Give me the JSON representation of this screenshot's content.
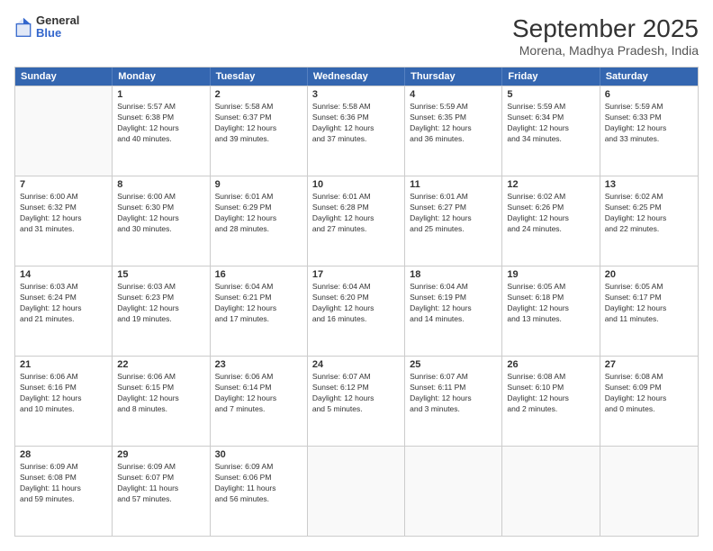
{
  "logo": {
    "line1": "General",
    "line2": "Blue"
  },
  "header": {
    "month": "September 2025",
    "location": "Morena, Madhya Pradesh, India"
  },
  "days_of_week": [
    "Sunday",
    "Monday",
    "Tuesday",
    "Wednesday",
    "Thursday",
    "Friday",
    "Saturday"
  ],
  "weeks": [
    [
      {
        "num": "",
        "info": ""
      },
      {
        "num": "1",
        "info": "Sunrise: 5:57 AM\nSunset: 6:38 PM\nDaylight: 12 hours\nand 40 minutes."
      },
      {
        "num": "2",
        "info": "Sunrise: 5:58 AM\nSunset: 6:37 PM\nDaylight: 12 hours\nand 39 minutes."
      },
      {
        "num": "3",
        "info": "Sunrise: 5:58 AM\nSunset: 6:36 PM\nDaylight: 12 hours\nand 37 minutes."
      },
      {
        "num": "4",
        "info": "Sunrise: 5:59 AM\nSunset: 6:35 PM\nDaylight: 12 hours\nand 36 minutes."
      },
      {
        "num": "5",
        "info": "Sunrise: 5:59 AM\nSunset: 6:34 PM\nDaylight: 12 hours\nand 34 minutes."
      },
      {
        "num": "6",
        "info": "Sunrise: 5:59 AM\nSunset: 6:33 PM\nDaylight: 12 hours\nand 33 minutes."
      }
    ],
    [
      {
        "num": "7",
        "info": "Sunrise: 6:00 AM\nSunset: 6:32 PM\nDaylight: 12 hours\nand 31 minutes."
      },
      {
        "num": "8",
        "info": "Sunrise: 6:00 AM\nSunset: 6:30 PM\nDaylight: 12 hours\nand 30 minutes."
      },
      {
        "num": "9",
        "info": "Sunrise: 6:01 AM\nSunset: 6:29 PM\nDaylight: 12 hours\nand 28 minutes."
      },
      {
        "num": "10",
        "info": "Sunrise: 6:01 AM\nSunset: 6:28 PM\nDaylight: 12 hours\nand 27 minutes."
      },
      {
        "num": "11",
        "info": "Sunrise: 6:01 AM\nSunset: 6:27 PM\nDaylight: 12 hours\nand 25 minutes."
      },
      {
        "num": "12",
        "info": "Sunrise: 6:02 AM\nSunset: 6:26 PM\nDaylight: 12 hours\nand 24 minutes."
      },
      {
        "num": "13",
        "info": "Sunrise: 6:02 AM\nSunset: 6:25 PM\nDaylight: 12 hours\nand 22 minutes."
      }
    ],
    [
      {
        "num": "14",
        "info": "Sunrise: 6:03 AM\nSunset: 6:24 PM\nDaylight: 12 hours\nand 21 minutes."
      },
      {
        "num": "15",
        "info": "Sunrise: 6:03 AM\nSunset: 6:23 PM\nDaylight: 12 hours\nand 19 minutes."
      },
      {
        "num": "16",
        "info": "Sunrise: 6:04 AM\nSunset: 6:21 PM\nDaylight: 12 hours\nand 17 minutes."
      },
      {
        "num": "17",
        "info": "Sunrise: 6:04 AM\nSunset: 6:20 PM\nDaylight: 12 hours\nand 16 minutes."
      },
      {
        "num": "18",
        "info": "Sunrise: 6:04 AM\nSunset: 6:19 PM\nDaylight: 12 hours\nand 14 minutes."
      },
      {
        "num": "19",
        "info": "Sunrise: 6:05 AM\nSunset: 6:18 PM\nDaylight: 12 hours\nand 13 minutes."
      },
      {
        "num": "20",
        "info": "Sunrise: 6:05 AM\nSunset: 6:17 PM\nDaylight: 12 hours\nand 11 minutes."
      }
    ],
    [
      {
        "num": "21",
        "info": "Sunrise: 6:06 AM\nSunset: 6:16 PM\nDaylight: 12 hours\nand 10 minutes."
      },
      {
        "num": "22",
        "info": "Sunrise: 6:06 AM\nSunset: 6:15 PM\nDaylight: 12 hours\nand 8 minutes."
      },
      {
        "num": "23",
        "info": "Sunrise: 6:06 AM\nSunset: 6:14 PM\nDaylight: 12 hours\nand 7 minutes."
      },
      {
        "num": "24",
        "info": "Sunrise: 6:07 AM\nSunset: 6:12 PM\nDaylight: 12 hours\nand 5 minutes."
      },
      {
        "num": "25",
        "info": "Sunrise: 6:07 AM\nSunset: 6:11 PM\nDaylight: 12 hours\nand 3 minutes."
      },
      {
        "num": "26",
        "info": "Sunrise: 6:08 AM\nSunset: 6:10 PM\nDaylight: 12 hours\nand 2 minutes."
      },
      {
        "num": "27",
        "info": "Sunrise: 6:08 AM\nSunset: 6:09 PM\nDaylight: 12 hours\nand 0 minutes."
      }
    ],
    [
      {
        "num": "28",
        "info": "Sunrise: 6:09 AM\nSunset: 6:08 PM\nDaylight: 11 hours\nand 59 minutes."
      },
      {
        "num": "29",
        "info": "Sunrise: 6:09 AM\nSunset: 6:07 PM\nDaylight: 11 hours\nand 57 minutes."
      },
      {
        "num": "30",
        "info": "Sunrise: 6:09 AM\nSunset: 6:06 PM\nDaylight: 11 hours\nand 56 minutes."
      },
      {
        "num": "",
        "info": ""
      },
      {
        "num": "",
        "info": ""
      },
      {
        "num": "",
        "info": ""
      },
      {
        "num": "",
        "info": ""
      }
    ]
  ]
}
